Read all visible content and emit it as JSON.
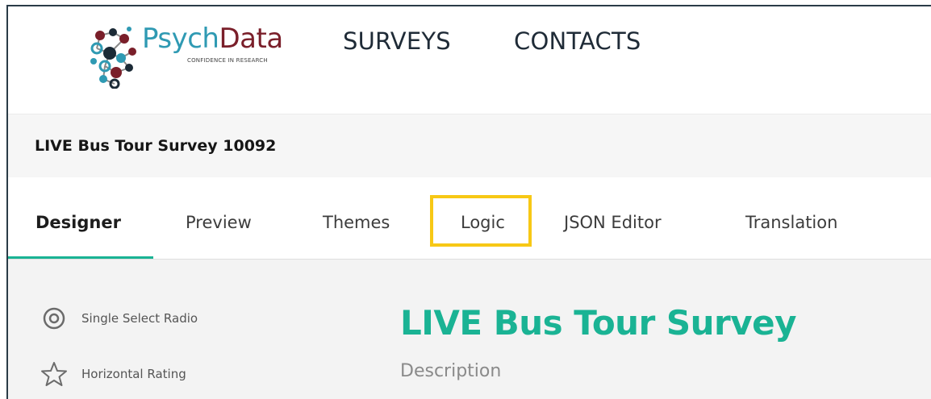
{
  "header": {
    "logo": {
      "word_part1": "Psych",
      "word_part2": "Data",
      "tagline": "CONFIDENCE IN RESEARCH"
    },
    "nav": [
      "SURVEYS",
      "CONTACTS"
    ]
  },
  "survey": {
    "name": "LIVE Bus Tour Survey 10092"
  },
  "tabs": [
    {
      "label": "Designer",
      "active": true
    },
    {
      "label": "Preview"
    },
    {
      "label": "Themes"
    },
    {
      "label": "Logic",
      "highlighted": true
    },
    {
      "label": "JSON Editor"
    },
    {
      "label": "Translation"
    }
  ],
  "toolbox": [
    {
      "label": "Single Select Radio",
      "icon": "radio-icon"
    },
    {
      "label": "Horizontal Rating",
      "icon": "star-icon"
    }
  ],
  "canvas": {
    "title": "LIVE Bus Tour Survey",
    "description": "Description"
  },
  "colors": {
    "accent": "#1ab394",
    "highlight": "#f7c815",
    "logo_teal": "#2f9ab3",
    "logo_maroon": "#7a1f2a",
    "nav_text": "#1f2b37"
  }
}
